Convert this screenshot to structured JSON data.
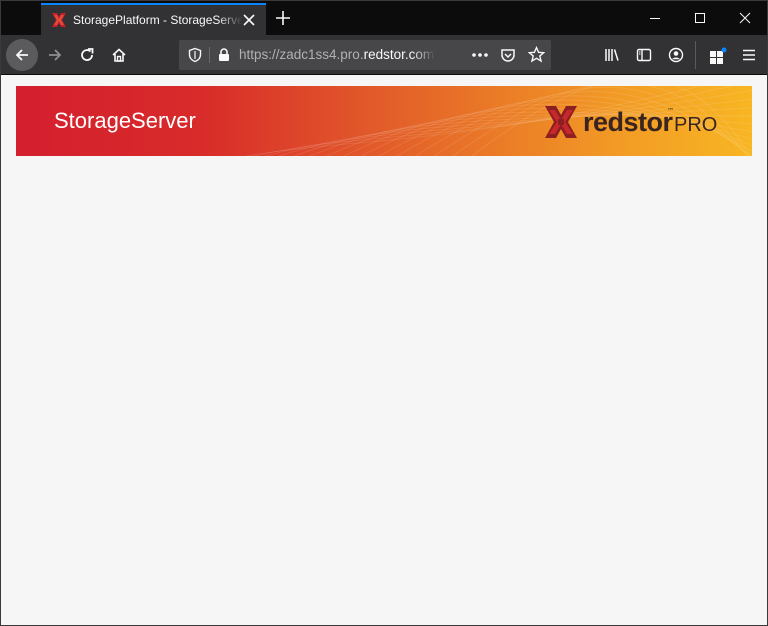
{
  "browser": {
    "tab": {
      "title": "StoragePlatform - StorageServer",
      "favicon": "redstor-favicon-icon"
    },
    "address_bar": {
      "url_prefix": "https://zadc1ss4.pro.",
      "url_domain": "redstor.com"
    },
    "accent_color": "#0a84ff"
  },
  "page": {
    "banner": {
      "title": "StorageServer",
      "logo": {
        "word": "redstor",
        "tm": "™",
        "suffix": "PRO"
      },
      "gradient_colors": [
        "#d41f2e",
        "#f8b623"
      ]
    },
    "background_color": "#f6f6f6"
  }
}
